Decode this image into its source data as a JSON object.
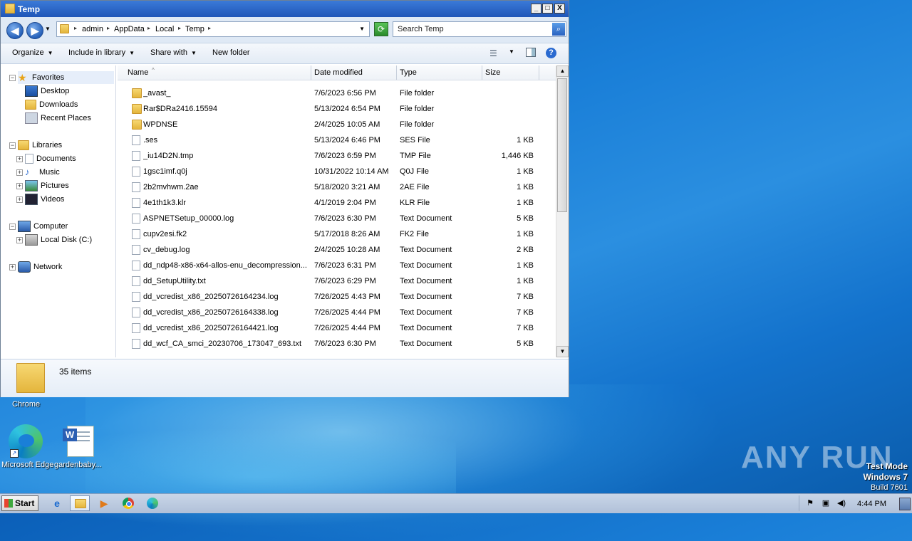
{
  "window": {
    "title": "Temp",
    "controls": {
      "minimize": "_",
      "maximize": "□",
      "close": "X"
    }
  },
  "nav": {
    "back": "◀",
    "forward": "▶",
    "breadcrumb": [
      "admin",
      "AppData",
      "Local",
      "Temp"
    ],
    "search_placeholder": "Search Temp"
  },
  "toolbar": {
    "organize": "Organize",
    "include_in_library": "Include in library",
    "share_with": "Share with",
    "new_folder": "New folder"
  },
  "sidebar": {
    "favorites": "Favorites",
    "favorites_items": [
      "Desktop",
      "Downloads",
      "Recent Places"
    ],
    "libraries": "Libraries",
    "libraries_items": [
      "Documents",
      "Music",
      "Pictures",
      "Videos"
    ],
    "computer": "Computer",
    "computer_items": [
      "Local Disk (C:)"
    ],
    "network": "Network"
  },
  "columns": {
    "name": "Name",
    "date": "Date modified",
    "type": "Type",
    "size": "Size"
  },
  "files": [
    {
      "name": "_avast_",
      "date": "7/6/2023 6:56 PM",
      "type": "File folder",
      "size": "",
      "kind": "folder"
    },
    {
      "name": "Rar$DRa2416.15594",
      "date": "5/13/2024 6:54 PM",
      "type": "File folder",
      "size": "",
      "kind": "folder"
    },
    {
      "name": "WPDNSE",
      "date": "2/4/2025 10:05 AM",
      "type": "File folder",
      "size": "",
      "kind": "folder"
    },
    {
      "name": ".ses",
      "date": "5/13/2024 6:46 PM",
      "type": "SES File",
      "size": "1 KB",
      "kind": "file"
    },
    {
      "name": "_iu14D2N.tmp",
      "date": "7/6/2023 6:59 PM",
      "type": "TMP File",
      "size": "1,446 KB",
      "kind": "file"
    },
    {
      "name": "1gsc1imf.q0j",
      "date": "10/31/2022 10:14 AM",
      "type": "Q0J File",
      "size": "1 KB",
      "kind": "file"
    },
    {
      "name": "2b2mvhwm.2ae",
      "date": "5/18/2020 3:21 AM",
      "type": "2AE File",
      "size": "1 KB",
      "kind": "file"
    },
    {
      "name": "4e1th1k3.klr",
      "date": "4/1/2019 2:04 PM",
      "type": "KLR File",
      "size": "1 KB",
      "kind": "file"
    },
    {
      "name": "ASPNETSetup_00000.log",
      "date": "7/6/2023 6:30 PM",
      "type": "Text Document",
      "size": "5 KB",
      "kind": "file"
    },
    {
      "name": "cupv2esi.fk2",
      "date": "5/17/2018 8:26 AM",
      "type": "FK2 File",
      "size": "1 KB",
      "kind": "file"
    },
    {
      "name": "cv_debug.log",
      "date": "2/4/2025 10:28 AM",
      "type": "Text Document",
      "size": "2 KB",
      "kind": "file"
    },
    {
      "name": "dd_ndp48-x86-x64-allos-enu_decompression...",
      "date": "7/6/2023 6:31 PM",
      "type": "Text Document",
      "size": "1 KB",
      "kind": "file"
    },
    {
      "name": "dd_SetupUtility.txt",
      "date": "7/6/2023 6:29 PM",
      "type": "Text Document",
      "size": "1 KB",
      "kind": "file"
    },
    {
      "name": "dd_vcredist_x86_20250726164234.log",
      "date": "7/26/2025 4:43 PM",
      "type": "Text Document",
      "size": "7 KB",
      "kind": "file"
    },
    {
      "name": "dd_vcredist_x86_20250726164338.log",
      "date": "7/26/2025 4:44 PM",
      "type": "Text Document",
      "size": "7 KB",
      "kind": "file"
    },
    {
      "name": "dd_vcredist_x86_20250726164421.log",
      "date": "7/26/2025 4:44 PM",
      "type": "Text Document",
      "size": "7 KB",
      "kind": "file"
    },
    {
      "name": "dd_wcf_CA_smci_20230706_173047_693.txt",
      "date": "7/6/2023 6:30 PM",
      "type": "Text Document",
      "size": "5 KB",
      "kind": "file"
    }
  ],
  "details": {
    "item_count": "35 items"
  },
  "desktop": {
    "chrome_label": "Chrome",
    "edge_label": "Microsoft Edge",
    "word_label": "gardenbaby...",
    "watermark": "ANY RUN",
    "test_mode": {
      "line1": "Test Mode",
      "line2": "Windows 7",
      "line3": "Build 7601"
    }
  },
  "taskbar": {
    "start": "Start",
    "clock": "4:44 PM"
  }
}
